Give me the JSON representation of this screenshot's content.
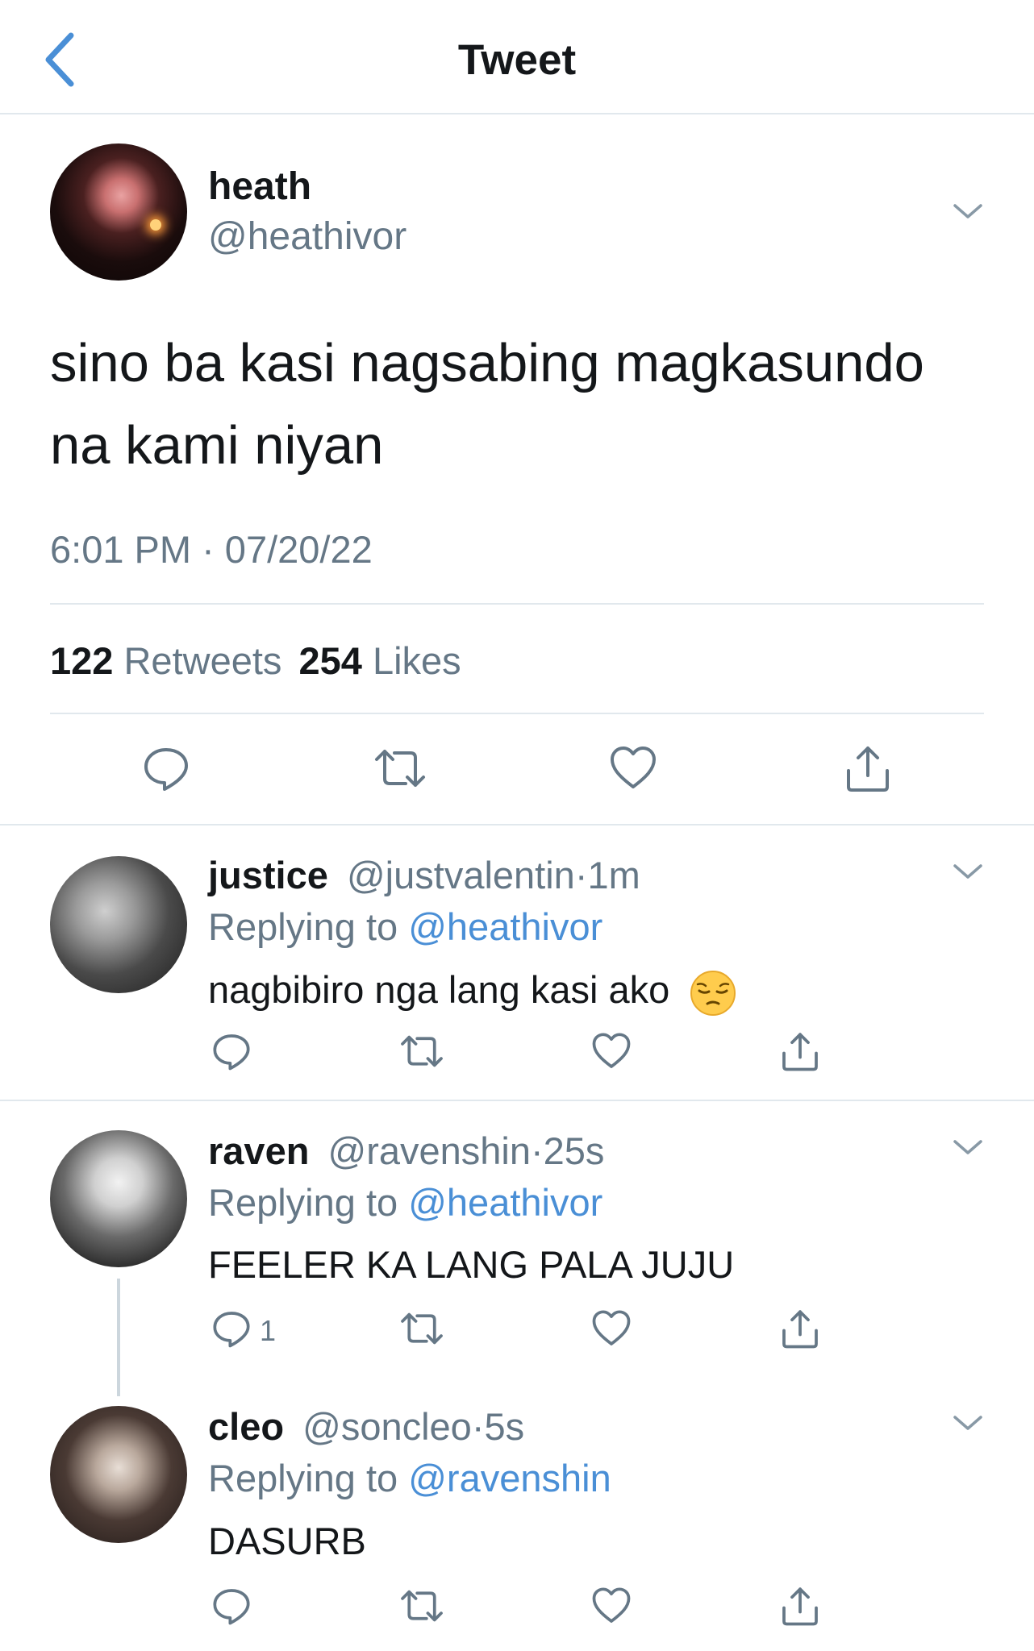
{
  "header": {
    "title": "Tweet"
  },
  "main_tweet": {
    "name": "heath",
    "handle": "@heathivor",
    "text_line1": "sino ba kasi nagsabing magkasundo",
    "text_line2": "na kami niyan",
    "timestamp": "6:01 PM · 07/20/22",
    "retweets_count": "122",
    "retweets_label": "Retweets",
    "likes_count": "254",
    "likes_label": "Likes"
  },
  "replies": [
    {
      "name": "justice",
      "handle": "@justvalentin",
      "sep": "·",
      "time": "1m",
      "replying_label": "Replying to",
      "replying_to": "@heathivor",
      "text": "nagbibiro nga lang kasi ako",
      "emoji": "pensive-face"
    },
    {
      "name": "raven",
      "handle": "@ravenshin",
      "sep": "·",
      "time": "25s",
      "replying_label": "Replying to",
      "replying_to": "@heathivor",
      "text": "FEELER KA LANG PALA JUJU",
      "reply_count": "1"
    },
    {
      "name": "cleo",
      "handle": "@soncleo",
      "sep": "·",
      "time": "5s",
      "replying_label": "Replying to",
      "replying_to": "@ravenshin",
      "text": "DASURB"
    }
  ],
  "colors": {
    "link": "#4a8fd6",
    "secondary_text": "#657786",
    "divider": "#e1e8ed"
  }
}
